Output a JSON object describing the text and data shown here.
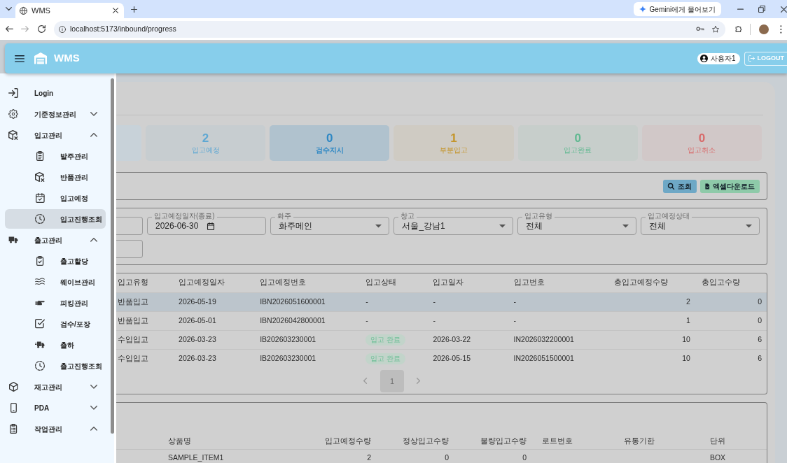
{
  "browser": {
    "tab_title": "WMS",
    "gemini_button": "Gemini에게 물어보기",
    "address": "localhost:5173/inbound/progress"
  },
  "app_bar": {
    "title": "WMS",
    "user": "사용자1",
    "logout_button": "LOGOUT"
  },
  "sidebar": {
    "items": [
      {
        "label": "Login",
        "kind": "link",
        "selected": false
      },
      {
        "label": "기준정보관리",
        "kind": "group",
        "expanded": false,
        "selected": false
      },
      {
        "label": "입고관리",
        "kind": "group",
        "expanded": true,
        "selected": false,
        "children": [
          {
            "label": "발주관리",
            "selected": false
          },
          {
            "label": "반품관리",
            "selected": false
          },
          {
            "label": "입고예정",
            "selected": false
          },
          {
            "label": "입고진행조회",
            "selected": true
          }
        ]
      },
      {
        "label": "출고관리",
        "kind": "group",
        "expanded": true,
        "selected": false,
        "children": [
          {
            "label": "출고할당",
            "selected": false
          },
          {
            "label": "웨이브관리",
            "selected": false
          },
          {
            "label": "피킹관리",
            "selected": false
          },
          {
            "label": "검수/포장",
            "selected": false
          },
          {
            "label": "출하",
            "selected": false
          },
          {
            "label": "출고진행조회",
            "selected": false
          }
        ]
      },
      {
        "label": "재고관리",
        "kind": "group",
        "expanded": false,
        "selected": false
      },
      {
        "label": "PDA",
        "kind": "group",
        "expanded": false,
        "selected": false
      },
      {
        "label": "작업관리",
        "kind": "group",
        "expanded": true,
        "selected": false
      }
    ]
  },
  "summary_cards": [
    {
      "count": "2",
      "label": "입고예정",
      "color": "#5fa8d3",
      "selected": false
    },
    {
      "count": "0",
      "label": "검수지시",
      "color": "#2f88c4",
      "selected": true
    },
    {
      "count": "1",
      "label": "부분입고",
      "color": "#c4952a",
      "selected": false
    },
    {
      "count": "0",
      "label": "입고완료",
      "color": "#5fb890",
      "selected": false
    },
    {
      "count": "0",
      "label": "입고취소",
      "color": "#d86a6a",
      "selected": false
    }
  ],
  "toolbar": {
    "buttons": [
      {
        "label": "조회",
        "kind": "search"
      },
      {
        "label": "엑셀다운로드",
        "kind": "excel"
      }
    ]
  },
  "filters": {
    "rows": [
      [
        {
          "kind": "cut"
        },
        {
          "kind": "date",
          "label": "입고예정일자(종료)",
          "value": "2026-06-30"
        },
        {
          "kind": "select",
          "label": "화주",
          "value": "화주메인"
        },
        {
          "kind": "select",
          "label": "창고",
          "value": "서울_강남1"
        },
        {
          "kind": "select",
          "label": "입고유형",
          "value": "전체"
        },
        {
          "kind": "select",
          "label": "입고예정상태",
          "value": "전체"
        }
      ],
      [
        {
          "kind": "cut"
        }
      ]
    ]
  },
  "inbound_table": {
    "columns": [
      "입고유형",
      "입고예정일자",
      "입고예정번호",
      "입고상태",
      "입고일자",
      "입고번호",
      "총입고예정수량",
      "총입고수량"
    ],
    "rows": [
      {
        "selected": true,
        "status_badge": false,
        "cells": [
          "반품입고",
          "2026-05-19",
          "IBN2026051600001",
          "-",
          "-",
          "-",
          "2",
          "0"
        ]
      },
      {
        "selected": false,
        "status_badge": false,
        "cells": [
          "반품입고",
          "2026-05-01",
          "IBN2026042800001",
          "-",
          "-",
          "-",
          "1",
          "0"
        ]
      },
      {
        "selected": false,
        "status_badge": true,
        "cells": [
          "수입입고",
          "2026-03-23",
          "IB202603230001",
          "입고 완료",
          "2026-03-22",
          "IN2026032200001",
          "10",
          "6"
        ]
      },
      {
        "selected": false,
        "status_badge": true,
        "cells": [
          "수입입고",
          "2026-03-23",
          "IB202603230001",
          "입고 완료",
          "2026-05-15",
          "IN2026051500001",
          "10",
          "6"
        ]
      }
    ],
    "pagination": {
      "pages": [
        {
          "label": "1",
          "selected": true
        }
      ]
    }
  },
  "detail_table": {
    "columns": [
      "상품명",
      "입고예정수량",
      "정상입고수량",
      "불량입고수량",
      "로트번호",
      "유통기한",
      "단위"
    ],
    "rows": [
      {
        "cells": [
          "SAMPLE_ITEM1",
          "2",
          "0",
          "0",
          null,
          null,
          "BOX"
        ]
      }
    ]
  }
}
